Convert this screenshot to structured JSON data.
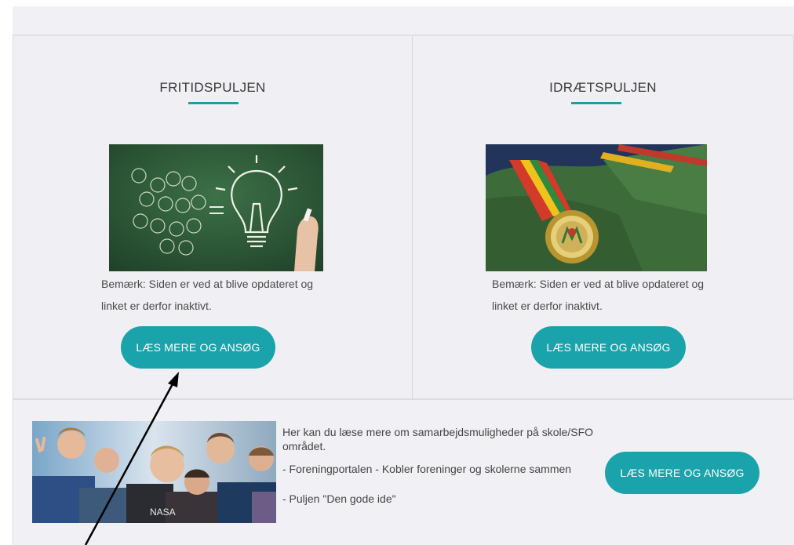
{
  "cards": [
    {
      "title": "FRITIDSPULJEN",
      "image": "lightbulb-chalkboard",
      "note": "Bemærk: Siden er ved at blive opdateret og linket er derfor inaktivt.",
      "button_label": "LÆS MERE OG ANSØG"
    },
    {
      "title": "IDRÆTSPULJEN",
      "image": "medals-on-velvet",
      "note": "Bemærk: Siden er ved at blive opdateret og linket er derfor inaktivt.",
      "button_label": "LÆS MERE OG ANSØG"
    }
  ],
  "bottom": {
    "image": "children-group-photo",
    "lines": [
      "Her kan du læse mere om samarbejdsmuligheder på skole/SFO området.",
      "- Foreningportalen - Kobler foreninger og skolerne sammen",
      "- Puljen \"Den gode ide\""
    ],
    "button_label": "LÆS MERE OG ANSØG"
  },
  "colors": {
    "accent": "#1aa3aa",
    "background": "#f1f1f5",
    "chalkboard": "#2f5c3a",
    "velvet": "#3d6b3a"
  }
}
